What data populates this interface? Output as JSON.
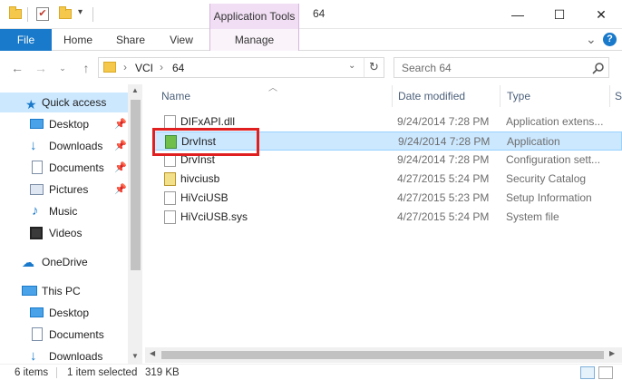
{
  "window": {
    "title": "64",
    "context_tab": "Application Tools",
    "minimize": "—",
    "maximize": "☐",
    "close": "✕"
  },
  "ribbon": {
    "file": "File",
    "home": "Home",
    "share": "Share",
    "view": "View",
    "manage": "Manage",
    "collapse": "⌄",
    "help": "?"
  },
  "address": {
    "segments": [
      "VCI",
      "64"
    ],
    "search_placeholder": "Search 64"
  },
  "nav": {
    "items": [
      {
        "label": "Quick access",
        "icon": "star-icon"
      },
      {
        "label": "Desktop",
        "icon": "desktop-icon",
        "pinned": true
      },
      {
        "label": "Downloads",
        "icon": "download-icon",
        "pinned": true
      },
      {
        "label": "Documents",
        "icon": "documents-icon",
        "pinned": true
      },
      {
        "label": "Pictures",
        "icon": "pictures-icon",
        "pinned": true
      },
      {
        "label": "Music",
        "icon": "music-icon"
      },
      {
        "label": "Videos",
        "icon": "videos-icon"
      },
      {
        "label": "OneDrive",
        "icon": "cloud-icon"
      },
      {
        "label": "This PC",
        "icon": "computer-icon"
      },
      {
        "label": "Desktop",
        "icon": "desktop-icon"
      },
      {
        "label": "Documents",
        "icon": "documents-icon"
      },
      {
        "label": "Downloads",
        "icon": "download-icon"
      }
    ]
  },
  "columns": {
    "name": "Name",
    "date": "Date modified",
    "type": "Type",
    "size": "S"
  },
  "files": [
    {
      "name": "DIFxAPI.dll",
      "date": "9/24/2014 7:28 PM",
      "type": "Application extens...",
      "icon": "dll-file-icon"
    },
    {
      "name": "DrvInst",
      "date": "9/24/2014 7:28 PM",
      "type": "Application",
      "icon": "installer-app-icon",
      "selected": true
    },
    {
      "name": "DrvInst",
      "date": "9/24/2014 7:28 PM",
      "type": "Configuration sett...",
      "icon": "config-file-icon"
    },
    {
      "name": "hivciusb",
      "date": "4/27/2015 5:24 PM",
      "type": "Security Catalog",
      "icon": "catalog-file-icon"
    },
    {
      "name": "HiVciUSB",
      "date": "4/27/2015 5:23 PM",
      "type": "Setup Information",
      "icon": "inf-file-icon"
    },
    {
      "name": "HiVciUSB.sys",
      "date": "4/27/2015 5:24 PM",
      "type": "System file",
      "icon": "sys-file-icon"
    }
  ],
  "status": {
    "count": "6 items",
    "selection": "1 item selected",
    "size": "319 KB"
  },
  "colors": {
    "accent": "#1979ca",
    "selection": "#cce8ff",
    "highlight_border": "#e02020",
    "context_tab": "#f1def4"
  }
}
